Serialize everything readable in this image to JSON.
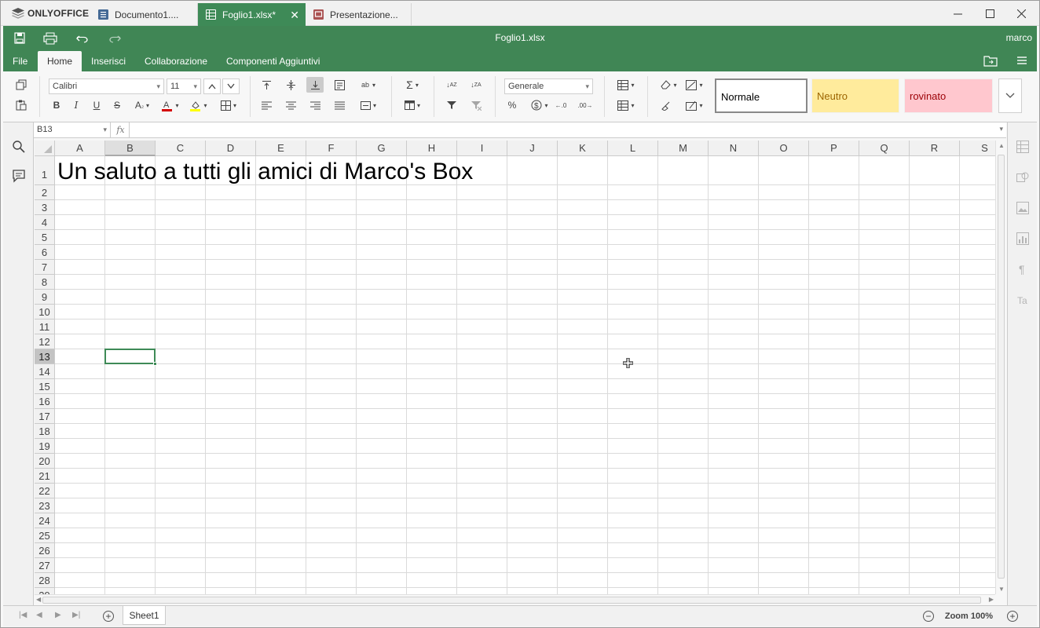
{
  "app": {
    "brand": "ONLYOFFICE",
    "tabs": [
      {
        "label": "Documento1....",
        "type": "document",
        "color": "#446995"
      },
      {
        "label": "Foglio1.xlsx*",
        "type": "spreadsheet",
        "color": "#3e8a57",
        "active": true
      },
      {
        "label": "Presentazione...",
        "type": "presentation",
        "color": "#aa5252"
      }
    ],
    "window_controls": [
      "minimize-icon",
      "maximize-icon",
      "close-icon"
    ]
  },
  "header": {
    "doc_title": "Foglio1.xlsx",
    "user": "marco",
    "menu_tabs": [
      "File",
      "Home",
      "Inserisci",
      "Collaborazione",
      "Componenti Aggiuntivi"
    ],
    "active_tab": "Home"
  },
  "toolbar": {
    "font_name": "Calibri",
    "font_size": "11",
    "number_format": "Generale",
    "styles": {
      "normal": "Normale",
      "neutral": "Neutro",
      "bad": "rovinato"
    }
  },
  "formula_bar": {
    "name_box": "B13",
    "fx_label": "fx",
    "formula": ""
  },
  "sheet": {
    "columns": [
      "A",
      "B",
      "C",
      "D",
      "E",
      "F",
      "G",
      "H",
      "I",
      "J",
      "K",
      "L",
      "M",
      "N",
      "O",
      "P",
      "Q",
      "R",
      "S"
    ],
    "selected_column": "B",
    "rows": [
      "1",
      "2",
      "3",
      "4",
      "5",
      "6",
      "7",
      "8",
      "9",
      "10",
      "11",
      "12",
      "13",
      "14",
      "15",
      "16",
      "17",
      "18",
      "19",
      "20",
      "21",
      "22",
      "23",
      "24",
      "25",
      "26",
      "27",
      "28",
      "29"
    ],
    "selected_row": "13",
    "cells": {
      "A1": "Un saluto a tutti gli amici di Marco's Box"
    }
  },
  "statusbar": {
    "sheet_tabs": [
      "Sheet1"
    ],
    "zoom": "Zoom 100%"
  },
  "colors": {
    "accent": "#408655",
    "neutral_bg": "#ffeb9c",
    "bad_bg": "#ffc7ce"
  }
}
